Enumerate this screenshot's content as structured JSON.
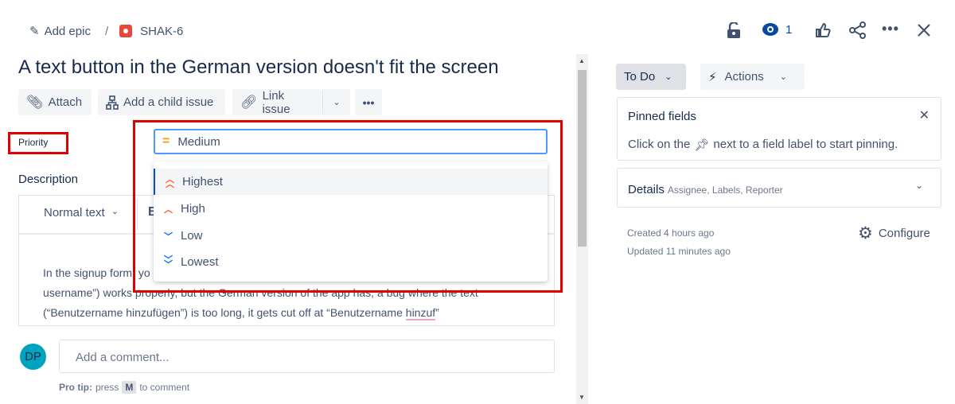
{
  "breadcrumb": {
    "add_epic": "Add epic",
    "separator": "/",
    "issue_key": "SHAK-6"
  },
  "header_icons": {
    "watch_count": "1",
    "icons": [
      "lock-icon",
      "eye-icon",
      "thumbs-up-icon",
      "share-icon",
      "more-icon",
      "close-icon"
    ]
  },
  "issue": {
    "title": "A text button in the German version doesn't fit the screen"
  },
  "toolbar": {
    "attach": "Attach",
    "add_child": "Add a child issue",
    "link_issue": "Link issue"
  },
  "priority": {
    "label": "Priority",
    "value": "Medium",
    "options": [
      {
        "label": "Highest",
        "color": "#ff5630"
      },
      {
        "label": "High",
        "color": "#ff5630"
      },
      {
        "label": "Low",
        "color": "#0065ff"
      },
      {
        "label": "Lowest",
        "color": "#0065ff"
      }
    ],
    "medium_color": "#ff991f"
  },
  "description": {
    "label": "Description",
    "text_style": "Normal text",
    "bold": "B",
    "line1": "In the signup form, yo",
    "line2": "username”) works properly, but the German version of the app has, a bug where the text",
    "line3a": "(“Benutzername hinzufügen”) is too long",
    ", ": "",
    "line3b": ", it gets cut off at “Benutzername ",
    "line3c": "hinzuf",
    "line3d": "”"
  },
  "comment": {
    "avatar": "DP",
    "placeholder": "Add a comment...",
    "tip_bold": "Pro tip:",
    "tip_press": "press",
    "tip_key": "M",
    "tip_rest": "to comment"
  },
  "sidebar": {
    "status": "To Do",
    "actions": "Actions",
    "pinned_title": "Pinned fields",
    "pinned_text_a": "Click on the",
    "pinned_text_b": "next to a field label to start pinning.",
    "details": "Details",
    "details_sub": "Assignee, Labels, Reporter",
    "created": "Created 4 hours ago",
    "updated": "Updated 11 minutes ago",
    "configure": "Configure"
  },
  "colors": {
    "accent": "#4c9aff",
    "highlight_border": "#e00000",
    "avatar": "#00a3bf"
  }
}
